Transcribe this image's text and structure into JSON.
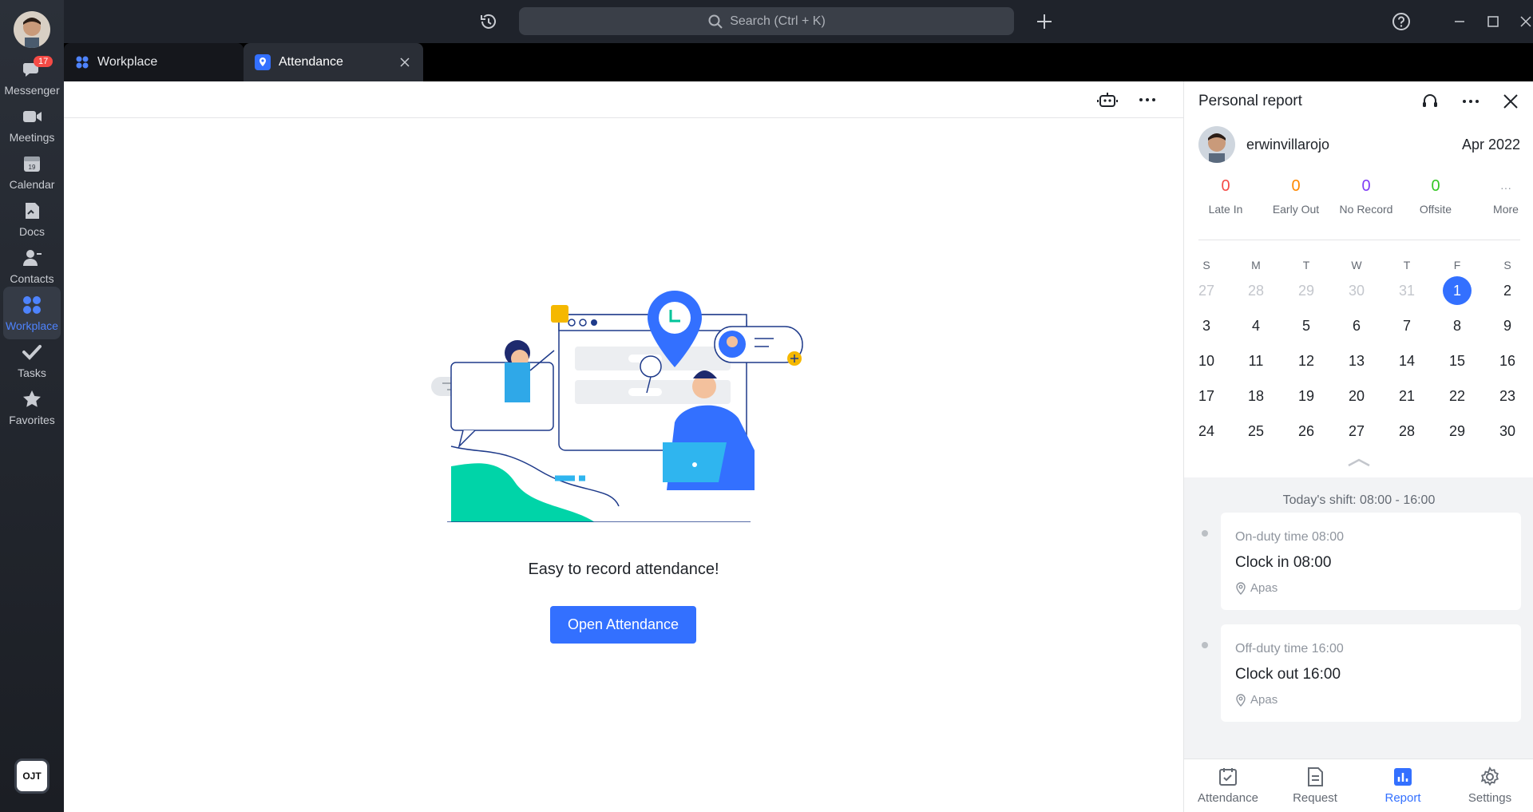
{
  "rail": {
    "messenger_badge": "17",
    "items": [
      {
        "label": "Messenger",
        "icon": "chat-bubble-icon"
      },
      {
        "label": "Meetings",
        "icon": "video-camera-icon"
      },
      {
        "label": "Calendar",
        "icon": "calendar-icon"
      },
      {
        "label": "Docs",
        "icon": "docs-icon"
      },
      {
        "label": "Contacts",
        "icon": "contacts-icon"
      },
      {
        "label": "Workplace",
        "icon": "grid-apps-icon"
      },
      {
        "label": "Tasks",
        "icon": "checkmark-icon"
      },
      {
        "label": "Favorites",
        "icon": "star-icon"
      }
    ],
    "active": "Workplace",
    "logo_text": "OJT"
  },
  "titlebar": {
    "search_placeholder": "Search (Ctrl + K)"
  },
  "tabs": [
    {
      "label": "Workplace"
    },
    {
      "label": "Attendance"
    }
  ],
  "main": {
    "message": "Easy to record attendance!",
    "open_button": "Open Attendance"
  },
  "panel": {
    "title": "Personal report",
    "username": "erwinvillarojo",
    "month": "Apr 2022",
    "stats": [
      {
        "value": "0",
        "label": "Late In",
        "color": "#f54a45"
      },
      {
        "value": "0",
        "label": "Early Out",
        "color": "#ff8800"
      },
      {
        "value": "0",
        "label": "No Record",
        "color": "#7f3bf5"
      },
      {
        "value": "0",
        "label": "Offsite",
        "color": "#34c724"
      },
      {
        "value": "···",
        "label": "More",
        "color": "#8f959e"
      }
    ],
    "weekdays": [
      "S",
      "M",
      "T",
      "W",
      "T",
      "F",
      "S"
    ],
    "weeks": [
      [
        "27",
        "28",
        "29",
        "30",
        "31",
        "1",
        "2"
      ],
      [
        "3",
        "4",
        "5",
        "6",
        "7",
        "8",
        "9"
      ],
      [
        "10",
        "11",
        "12",
        "13",
        "14",
        "15",
        "16"
      ],
      [
        "17",
        "18",
        "19",
        "20",
        "21",
        "22",
        "23"
      ],
      [
        "24",
        "25",
        "26",
        "27",
        "28",
        "29",
        "30"
      ]
    ],
    "selected_day": "1",
    "shift": "Today's shift: 08:00 - 16:00",
    "cards": [
      {
        "sub": "On-duty time 08:00",
        "main": "Clock in 08:00",
        "loc": "Apas"
      },
      {
        "sub": "Off-duty time 16:00",
        "main": "Clock out 16:00",
        "loc": "Apas"
      }
    ],
    "bottom_nav": [
      {
        "label": "Attendance"
      },
      {
        "label": "Request"
      },
      {
        "label": "Report"
      },
      {
        "label": "Settings"
      }
    ],
    "bottom_active": "Report"
  }
}
